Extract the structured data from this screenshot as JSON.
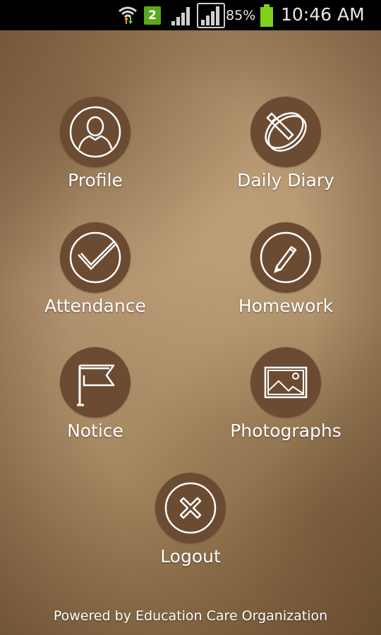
{
  "status_bar": {
    "notification_badge": "2",
    "battery_percent": "85%",
    "time": "10:46 AM",
    "icons": [
      "wifi-data-icon",
      "notification-badge-icon",
      "signal-icon",
      "signal-roaming-icon",
      "battery-icon"
    ]
  },
  "menu": {
    "items": [
      {
        "label": "Profile",
        "icon": "profile-icon"
      },
      {
        "label": "Daily Diary",
        "icon": "diary-icon"
      },
      {
        "label": "Attendance",
        "icon": "checkmark-icon"
      },
      {
        "label": "Homework",
        "icon": "pencil-icon"
      },
      {
        "label": "Notice",
        "icon": "flag-icon"
      },
      {
        "label": "Photographs",
        "icon": "photo-icon"
      },
      {
        "label": "Logout",
        "icon": "close-icon"
      }
    ]
  },
  "footer": {
    "text": "Powered by Education Care Organization"
  },
  "colors": {
    "icon_circle": "#6b4c33",
    "background": "#a88a64",
    "label_text": "#ffffff",
    "battery": "#7fd11b"
  }
}
